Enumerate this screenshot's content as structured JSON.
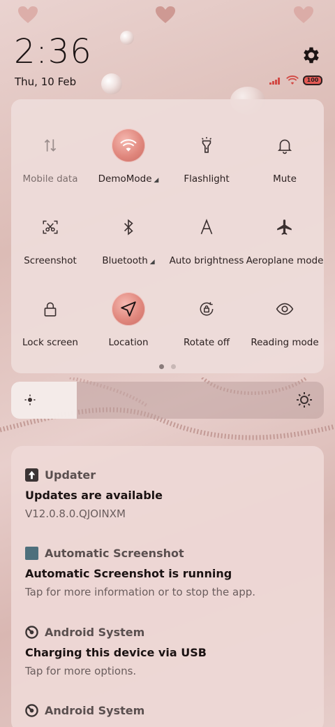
{
  "status": {
    "time": "2:36",
    "date": "Thu, 10 Feb",
    "battery": "100"
  },
  "quick_settings": {
    "tiles": [
      {
        "label": "Mobile data",
        "icon": "mobile-data-icon",
        "active": false,
        "dim": true
      },
      {
        "label": "DemoMode",
        "icon": "wifi-icon",
        "active": true,
        "caret": true
      },
      {
        "label": "Flashlight",
        "icon": "flashlight-icon",
        "active": false
      },
      {
        "label": "Mute",
        "icon": "bell-icon",
        "active": false
      },
      {
        "label": "Screenshot",
        "icon": "screenshot-icon",
        "active": false
      },
      {
        "label": "Bluetooth",
        "icon": "bluetooth-icon",
        "active": false,
        "caret": true
      },
      {
        "label": "Auto brightness",
        "icon": "auto-brightness-icon",
        "active": false
      },
      {
        "label": "Aeroplane mode",
        "icon": "airplane-icon",
        "active": false
      },
      {
        "label": "Lock screen",
        "icon": "lock-icon",
        "active": false
      },
      {
        "label": "Location",
        "icon": "location-icon",
        "active": true
      },
      {
        "label": "Rotate off",
        "icon": "rotate-lock-icon",
        "active": false
      },
      {
        "label": "Reading mode",
        "icon": "eye-icon",
        "active": false
      }
    ],
    "page_count": 2,
    "current_page": 1
  },
  "brightness": {
    "level": 0.21
  },
  "notifications": [
    {
      "app": "Updater",
      "icon": "updater-icon",
      "title": "Updates are available",
      "body": "V12.0.8.0.QJOINXM"
    },
    {
      "app": "Automatic Screenshot",
      "icon": "screenshot-app-icon",
      "title": "Automatic Screenshot is running",
      "body": "Tap for more information or to stop the app."
    },
    {
      "app": "Android System",
      "icon": "android-system-icon",
      "title": "Charging this device via USB",
      "body": "Tap for more options."
    },
    {
      "app": "Android System",
      "icon": "android-system-icon",
      "title": "",
      "body": ""
    }
  ],
  "colors": {
    "accent": "#e0877d",
    "panel": "#eedcda",
    "text": "#2b2020",
    "dim_text": "#7c6e6d"
  }
}
